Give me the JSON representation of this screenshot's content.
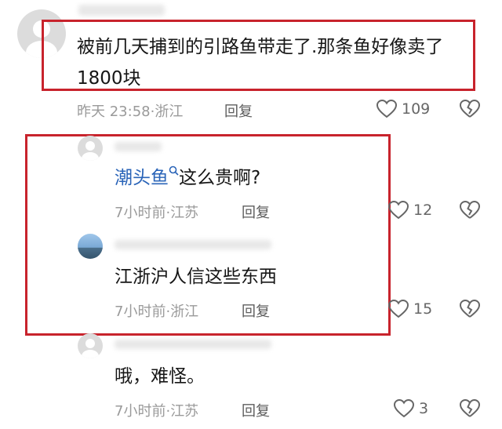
{
  "comments": [
    {
      "text": "被前几天捕到的引路鱼带走了.那条鱼好像卖了1800块",
      "time": "昨天 23:58",
      "location": "浙江",
      "reply_label": "回复",
      "likes": "109"
    },
    {
      "link_text": "潮头鱼",
      "text": "这么贵啊?",
      "time": "7小时前",
      "location": "江苏",
      "reply_label": "回复",
      "likes": "12"
    },
    {
      "text": "江浙沪人信这些东西",
      "time": "7小时前",
      "location": "浙江",
      "reply_label": "回复",
      "likes": "15"
    },
    {
      "text": "哦，难怪。",
      "time": "7小时前",
      "location": "江苏",
      "reply_label": "回复",
      "likes": "3"
    }
  ],
  "separator": "·",
  "icons": {
    "like": "heart-icon",
    "dislike": "broken-heart-icon",
    "search": "search-icon"
  },
  "colors": {
    "highlight_box": "#c8232c",
    "link": "#2a64b8"
  }
}
